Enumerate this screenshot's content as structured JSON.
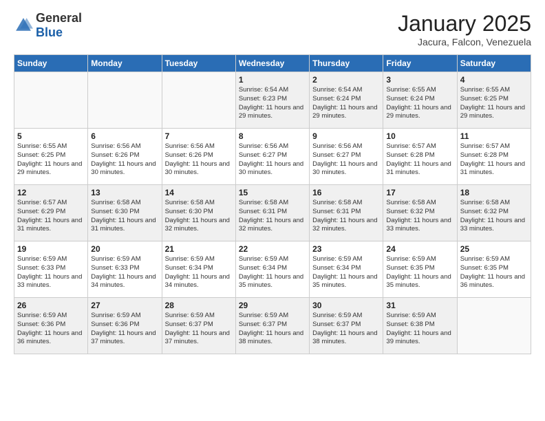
{
  "header": {
    "logo_general": "General",
    "logo_blue": "Blue",
    "month_title": "January 2025",
    "location": "Jacura, Falcon, Venezuela"
  },
  "days_of_week": [
    "Sunday",
    "Monday",
    "Tuesday",
    "Wednesday",
    "Thursday",
    "Friday",
    "Saturday"
  ],
  "weeks": [
    [
      {
        "day": "",
        "sunrise": "",
        "sunset": "",
        "daylight": ""
      },
      {
        "day": "",
        "sunrise": "",
        "sunset": "",
        "daylight": ""
      },
      {
        "day": "",
        "sunrise": "",
        "sunset": "",
        "daylight": ""
      },
      {
        "day": "1",
        "sunrise": "6:54 AM",
        "sunset": "6:23 PM",
        "daylight": "11 hours and 29 minutes."
      },
      {
        "day": "2",
        "sunrise": "6:54 AM",
        "sunset": "6:24 PM",
        "daylight": "11 hours and 29 minutes."
      },
      {
        "day": "3",
        "sunrise": "6:55 AM",
        "sunset": "6:24 PM",
        "daylight": "11 hours and 29 minutes."
      },
      {
        "day": "4",
        "sunrise": "6:55 AM",
        "sunset": "6:25 PM",
        "daylight": "11 hours and 29 minutes."
      }
    ],
    [
      {
        "day": "5",
        "sunrise": "6:55 AM",
        "sunset": "6:25 PM",
        "daylight": "11 hours and 29 minutes."
      },
      {
        "day": "6",
        "sunrise": "6:56 AM",
        "sunset": "6:26 PM",
        "daylight": "11 hours and 30 minutes."
      },
      {
        "day": "7",
        "sunrise": "6:56 AM",
        "sunset": "6:26 PM",
        "daylight": "11 hours and 30 minutes."
      },
      {
        "day": "8",
        "sunrise": "6:56 AM",
        "sunset": "6:27 PM",
        "daylight": "11 hours and 30 minutes."
      },
      {
        "day": "9",
        "sunrise": "6:56 AM",
        "sunset": "6:27 PM",
        "daylight": "11 hours and 30 minutes."
      },
      {
        "day": "10",
        "sunrise": "6:57 AM",
        "sunset": "6:28 PM",
        "daylight": "11 hours and 31 minutes."
      },
      {
        "day": "11",
        "sunrise": "6:57 AM",
        "sunset": "6:28 PM",
        "daylight": "11 hours and 31 minutes."
      }
    ],
    [
      {
        "day": "12",
        "sunrise": "6:57 AM",
        "sunset": "6:29 PM",
        "daylight": "11 hours and 31 minutes."
      },
      {
        "day": "13",
        "sunrise": "6:58 AM",
        "sunset": "6:30 PM",
        "daylight": "11 hours and 31 minutes."
      },
      {
        "day": "14",
        "sunrise": "6:58 AM",
        "sunset": "6:30 PM",
        "daylight": "11 hours and 32 minutes."
      },
      {
        "day": "15",
        "sunrise": "6:58 AM",
        "sunset": "6:31 PM",
        "daylight": "11 hours and 32 minutes."
      },
      {
        "day": "16",
        "sunrise": "6:58 AM",
        "sunset": "6:31 PM",
        "daylight": "11 hours and 32 minutes."
      },
      {
        "day": "17",
        "sunrise": "6:58 AM",
        "sunset": "6:32 PM",
        "daylight": "11 hours and 33 minutes."
      },
      {
        "day": "18",
        "sunrise": "6:58 AM",
        "sunset": "6:32 PM",
        "daylight": "11 hours and 33 minutes."
      }
    ],
    [
      {
        "day": "19",
        "sunrise": "6:59 AM",
        "sunset": "6:33 PM",
        "daylight": "11 hours and 33 minutes."
      },
      {
        "day": "20",
        "sunrise": "6:59 AM",
        "sunset": "6:33 PM",
        "daylight": "11 hours and 34 minutes."
      },
      {
        "day": "21",
        "sunrise": "6:59 AM",
        "sunset": "6:34 PM",
        "daylight": "11 hours and 34 minutes."
      },
      {
        "day": "22",
        "sunrise": "6:59 AM",
        "sunset": "6:34 PM",
        "daylight": "11 hours and 35 minutes."
      },
      {
        "day": "23",
        "sunrise": "6:59 AM",
        "sunset": "6:34 PM",
        "daylight": "11 hours and 35 minutes."
      },
      {
        "day": "24",
        "sunrise": "6:59 AM",
        "sunset": "6:35 PM",
        "daylight": "11 hours and 35 minutes."
      },
      {
        "day": "25",
        "sunrise": "6:59 AM",
        "sunset": "6:35 PM",
        "daylight": "11 hours and 36 minutes."
      }
    ],
    [
      {
        "day": "26",
        "sunrise": "6:59 AM",
        "sunset": "6:36 PM",
        "daylight": "11 hours and 36 minutes."
      },
      {
        "day": "27",
        "sunrise": "6:59 AM",
        "sunset": "6:36 PM",
        "daylight": "11 hours and 37 minutes."
      },
      {
        "day": "28",
        "sunrise": "6:59 AM",
        "sunset": "6:37 PM",
        "daylight": "11 hours and 37 minutes."
      },
      {
        "day": "29",
        "sunrise": "6:59 AM",
        "sunset": "6:37 PM",
        "daylight": "11 hours and 38 minutes."
      },
      {
        "day": "30",
        "sunrise": "6:59 AM",
        "sunset": "6:37 PM",
        "daylight": "11 hours and 38 minutes."
      },
      {
        "day": "31",
        "sunrise": "6:59 AM",
        "sunset": "6:38 PM",
        "daylight": "11 hours and 39 minutes."
      },
      {
        "day": "",
        "sunrise": "",
        "sunset": "",
        "daylight": ""
      }
    ]
  ]
}
